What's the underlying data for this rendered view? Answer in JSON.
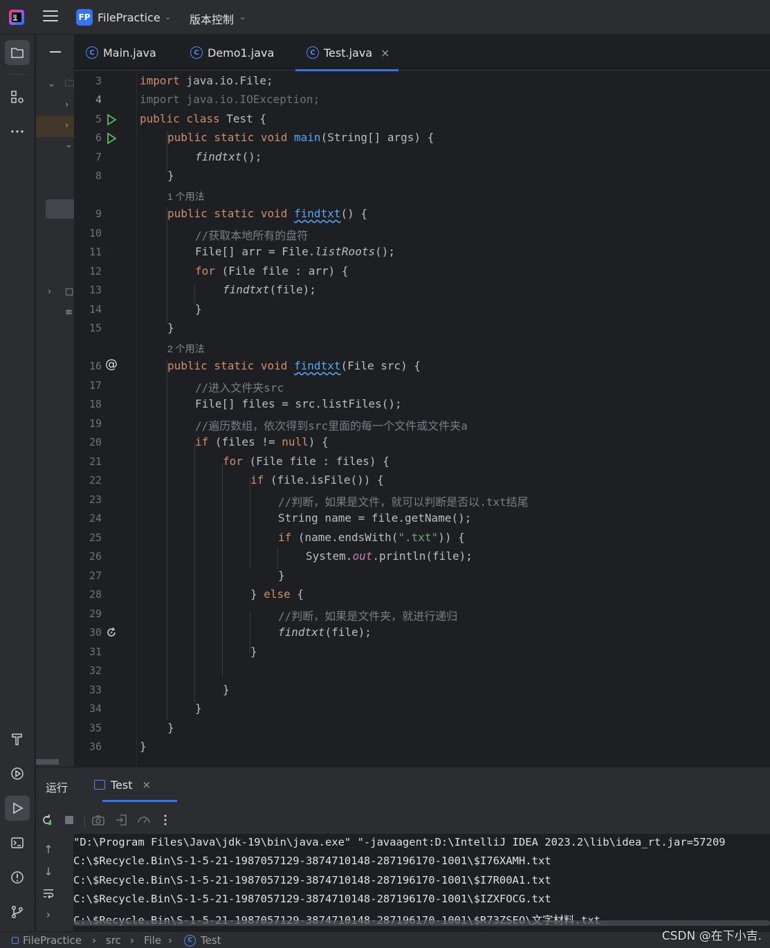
{
  "titlebar": {
    "project_badge": "FP",
    "project_name": "FilePractice",
    "vcs_label": "版本控制"
  },
  "tabs": [
    {
      "label": "Main.java",
      "icon": "class-icon"
    },
    {
      "label": "Demo1.java",
      "icon": "class-icon"
    },
    {
      "label": "Test.java",
      "icon": "class-icon",
      "active": true
    }
  ],
  "editor": {
    "lines": [
      {
        "n": "3"
      },
      {
        "n": "4"
      },
      {
        "n": "5"
      },
      {
        "n": "6"
      },
      {
        "n": "7"
      },
      {
        "n": "8"
      },
      {
        "n": "9"
      },
      {
        "n": "10"
      },
      {
        "n": "11"
      },
      {
        "n": "12"
      },
      {
        "n": "13"
      },
      {
        "n": "14"
      },
      {
        "n": "15"
      },
      {
        "n": "16"
      },
      {
        "n": "17"
      },
      {
        "n": "18"
      },
      {
        "n": "19"
      },
      {
        "n": "20"
      },
      {
        "n": "21"
      },
      {
        "n": "22"
      },
      {
        "n": "23"
      },
      {
        "n": "24"
      },
      {
        "n": "25"
      },
      {
        "n": "26"
      },
      {
        "n": "27"
      },
      {
        "n": "28"
      },
      {
        "n": "29"
      },
      {
        "n": "30"
      },
      {
        "n": "31"
      },
      {
        "n": "32"
      },
      {
        "n": "33"
      },
      {
        "n": "34"
      },
      {
        "n": "35"
      },
      {
        "n": "36"
      }
    ],
    "usage_hint_1": "1 个用法",
    "usage_hint_2": "2 个用法",
    "code": {
      "l3": [
        "import",
        " java.io.File;"
      ],
      "l4": "import java.io.IOException;",
      "l5": [
        "public class",
        " Test {"
      ],
      "l6": [
        "public static void",
        "main",
        "(String[] args) {"
      ],
      "l7": [
        "findtxt",
        "();"
      ],
      "l8": "}",
      "l9": [
        "public static void",
        "findtxt",
        "() {"
      ],
      "l10": "//获取本地所有的盘符",
      "l11": [
        "File[] arr = File.",
        "listRoots",
        "();"
      ],
      "l12": [
        "for",
        " (File file : arr) {"
      ],
      "l13": [
        "findtxt",
        "(file);"
      ],
      "l14": "}",
      "l15": "}",
      "l16": [
        "public static void",
        "findtxt",
        "(File src) {"
      ],
      "l17": "//进入文件夹src",
      "l18": "File[] files = src.listFiles();",
      "l19": "//遍历数组，依次得到src里面的每一个文件或文件夹a",
      "l20": [
        "if",
        " (files != ",
        "null",
        ") {"
      ],
      "l21": [
        "for",
        " (File file : files) {"
      ],
      "l22": [
        "if",
        " (file.isFile()) {"
      ],
      "l23": "//判断，如果是文件，就可以判断是否以.txt结尾",
      "l24": "String name = file.getName();",
      "l25": [
        "if",
        " (name.endsWith(",
        "\".txt\"",
        ")) {"
      ],
      "l26": [
        "System.",
        "out",
        ".println(file);"
      ],
      "l27": "}",
      "l28": [
        "} ",
        "else",
        " {"
      ],
      "l29": "//判断，如果是文件夹，就进行递归",
      "l30": [
        "findtxt",
        "(file);"
      ],
      "l31": "}",
      "l33": "}",
      "l34": "}",
      "l35": "}",
      "l36": "}"
    }
  },
  "run": {
    "title": "运行",
    "tab_label": "Test",
    "output": [
      "\"D:\\Program Files\\Java\\jdk-19\\bin\\java.exe\" \"-javaagent:D:\\IntelliJ IDEA 2023.2\\lib\\idea_rt.jar=57209",
      "C:\\$Recycle.Bin\\S-1-5-21-1987057129-3874710148-287196170-1001\\$I76XAMH.txt",
      "C:\\$Recycle.Bin\\S-1-5-21-1987057129-3874710148-287196170-1001\\$I7R00A1.txt",
      "C:\\$Recycle.Bin\\S-1-5-21-1987057129-3874710148-287196170-1001\\$IZXFOCG.txt",
      "C:\\$Recycle.Bin\\S-1-5-21-1987057129-3874710148-287196170-1001\\$R73ZSEO\\文字材料.txt"
    ]
  },
  "statusbar": {
    "breadcrumb": [
      "FilePractice",
      "src",
      "File",
      "Test"
    ]
  },
  "watermark": "CSDN @在下小吉."
}
